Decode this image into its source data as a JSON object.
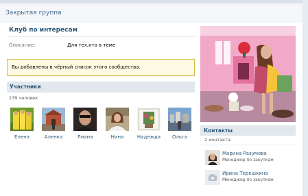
{
  "header": {
    "title": "Закрытая группа"
  },
  "group": {
    "name": "Клуб по интересам",
    "description_label": "Описание:",
    "description_value": "Для тех,кто в теме"
  },
  "notice": {
    "text": "Вы добавлены в чёрный список этого сообщества."
  },
  "members": {
    "title": "Участники",
    "count": "139 человек",
    "list": [
      {
        "name": "Елена"
      },
      {
        "name": "Аленка"
      },
      {
        "name": "Лиана"
      },
      {
        "name": "Нина"
      },
      {
        "name": "Надежда"
      },
      {
        "name": "Ольга"
      }
    ]
  },
  "contacts": {
    "title": "Контакты",
    "count": "2 контакта",
    "list": [
      {
        "name": "Марина Разумова",
        "role": "Менеджер по закупкам"
      },
      {
        "name": "Ирина Терешкина",
        "role": "Менеджер по закупкам"
      }
    ]
  }
}
